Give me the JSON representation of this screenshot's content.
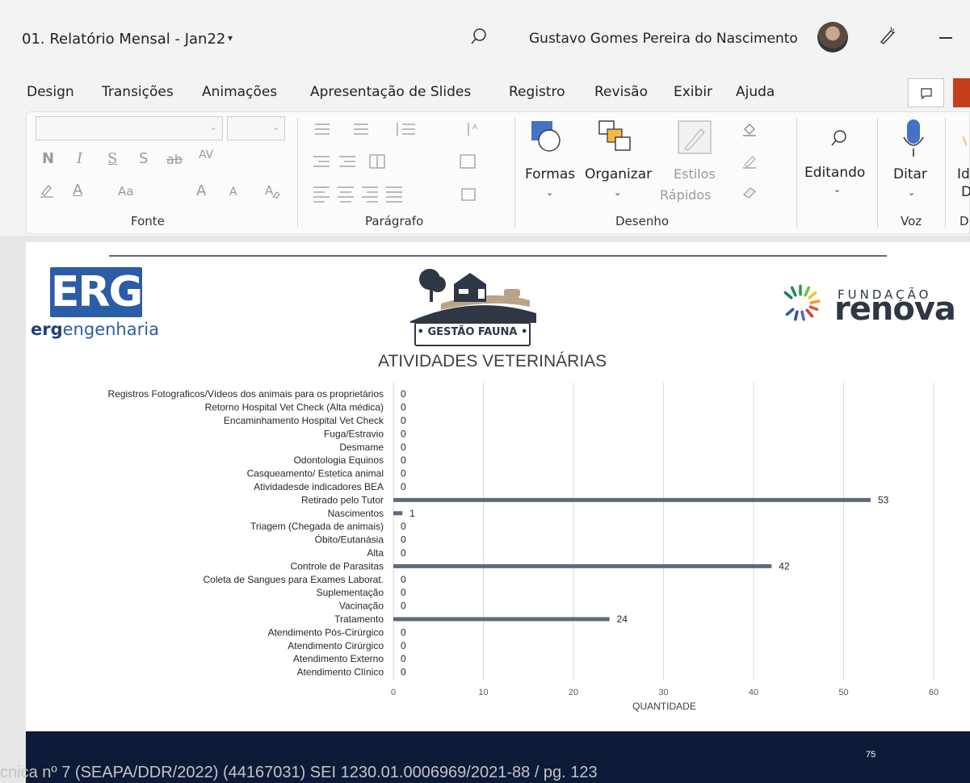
{
  "window": {
    "title": "01. Relatório Mensal - Jan22",
    "title_chevron": "▾",
    "user_name": "Gustavo Gomes Pereira do Nascimento"
  },
  "menu": {
    "items": [
      "Design",
      "Transições",
      "Animações",
      "Apresentação de Slides",
      "Registro",
      "Revisão",
      "Exibir",
      "Ajuda"
    ]
  },
  "ribbon": {
    "groups": {
      "font": "Fonte",
      "paragraph": "Parágrafo",
      "drawing": "Desenho",
      "voice": "Voz",
      "partial": "D"
    },
    "font_buttons": {
      "bold": "N",
      "italic": "I",
      "underline": "S",
      "shadow": "S",
      "strike": "ab",
      "spacing": "AV",
      "case": "Aa",
      "grow": "A",
      "shrink": "A"
    },
    "shapes_label": "Formas",
    "arrange_label": "Organizar",
    "quick_styles_label_1": "Estilos",
    "quick_styles_label_2": "Rápidos",
    "editing_label": "Editando",
    "dictate_label": "Ditar",
    "partial_label_1": "Id",
    "partial_label_2": "D"
  },
  "slide": {
    "erg_logo": "ERG",
    "erg_sub_bold": "erg",
    "erg_sub_rest": "engenharia",
    "fauna_badge": "• GESTÃO FAUNA •",
    "fundacao": "FUNDAÇÃO",
    "renova": "renova",
    "page_number": "75"
  },
  "chart_data": {
    "type": "bar",
    "orientation": "horizontal",
    "title": "ATIVIDADES VETERINÁRIAS",
    "xlabel": "QUANTIDADE",
    "ylabel": "",
    "xlim": [
      0,
      60
    ],
    "xticks": [
      0,
      10,
      20,
      30,
      40,
      50,
      60
    ],
    "grid": true,
    "color": "#5d6b7e",
    "categories": [
      "Registros Fotograficos/Vídeos dos animais para os proprietários",
      "Retorno Hospital Vet Check (Alta médica)",
      "Encaminhamento Hospital Vet Check",
      "Fuga/Estravio",
      "Desmame",
      "Odontologia Equinos",
      "Casqueamento/ Estetica animal",
      "Atividadesde indicadores BEA",
      "Retirado pelo Tutor",
      "Nascimentos",
      "Triagem (Chegada de animais)",
      "Óbito/Eutanásia",
      "Alta",
      "Controle de Parasitas",
      "Coleta de Sangues para Exames Laborat.",
      "Suplementação",
      "Vacinação",
      "Tratamento",
      "Atendimento Pós-Cirúrgico",
      "Atendimento Cirúrgico",
      "Atendimento Externo",
      "Atendimento Clínico"
    ],
    "values": [
      0,
      0,
      0,
      0,
      0,
      0,
      0,
      0,
      53,
      1,
      0,
      0,
      0,
      42,
      0,
      0,
      0,
      24,
      0,
      0,
      0,
      0
    ]
  },
  "footer": {
    "text": "cnica nº 7 (SEAPA/DDR/2022) (44167031)          SEI 1230.01.0006969/2021-88 / pg. 123"
  },
  "colors": {
    "accent_erg": "#2b5ca6",
    "share_button": "#c43e1c",
    "slide_bottom_bar": "#0d1a38",
    "bar": "#5d6b7e"
  }
}
